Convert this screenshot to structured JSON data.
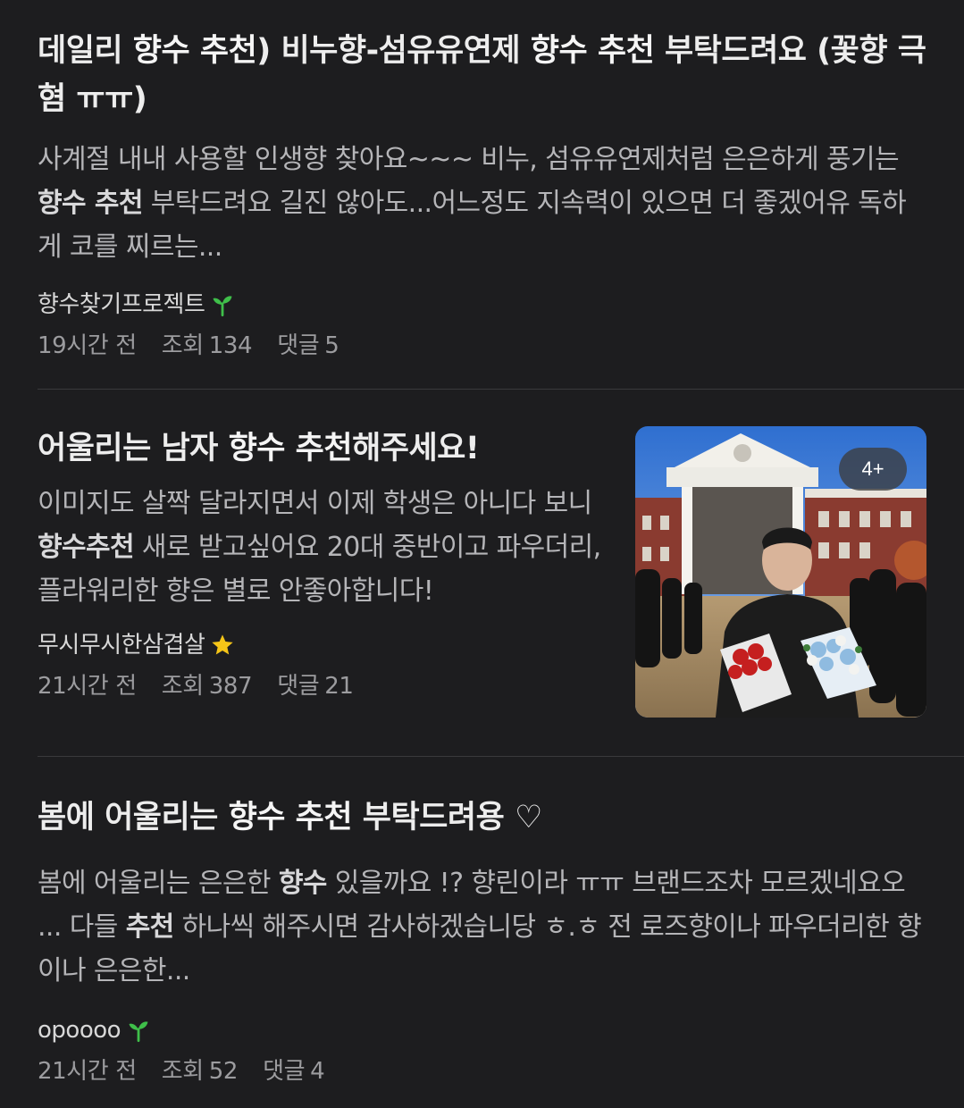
{
  "posts": [
    {
      "title_segments": [
        {
          "text": "데일리 ",
          "bold": false
        },
        {
          "text": "향수 추천",
          "bold": true
        },
        {
          "text": ") 비누향-섬유유연제 ",
          "bold": false
        },
        {
          "text": "향수 추천",
          "bold": true
        },
        {
          "text": " 부탁드려요 (꽃향 극혐 ㅠㅠ)",
          "bold": false
        }
      ],
      "snippet_segments": [
        {
          "text": "사계절 내내 사용할 인생향 찾아요~~~ 비누, 섬유유연제처럼 은은하게 풍기는 ",
          "bold": false
        },
        {
          "text": "향수 추천",
          "bold": true
        },
        {
          "text": " 부탁드려요 길진 않아도...어느정도 지속력이 있으면 더 좋겠어유 독하게 코를 찌르는...",
          "bold": false
        }
      ],
      "author": "향수찾기프로젝트",
      "author_badge_icon": "sprout-icon",
      "time": "19시간 전",
      "views_label": "조회",
      "views": "134",
      "comments_label": "댓글",
      "comments": "5"
    },
    {
      "title_segments": [
        {
          "text": "어울리는 남자 ",
          "bold": false
        },
        {
          "text": "향수 추천",
          "bold": true
        },
        {
          "text": "해주세요!",
          "bold": false
        }
      ],
      "snippet_segments": [
        {
          "text": "이미지도 살짝 달라지면서 이제 학생은 아니다 보니 ",
          "bold": false
        },
        {
          "text": "향수추천",
          "bold": true
        },
        {
          "text": " 새로 받고싶어요 20대 중반이고 파우더리, 플라워리한 향은 별로 안좋아합니다!",
          "bold": false
        }
      ],
      "author": "무시무시한삼겹살",
      "author_badge_icon": "star-icon",
      "time": "21시간 전",
      "views_label": "조회",
      "views": "387",
      "comments_label": "댓글",
      "comments": "21",
      "thumbnail_badge": "4+"
    },
    {
      "title_segments": [
        {
          "text": "봄에 어울리는 ",
          "bold": false
        },
        {
          "text": "향수 추천",
          "bold": true
        },
        {
          "text": " 부탁드려용 ♡",
          "bold": false
        }
      ],
      "snippet_segments": [
        {
          "text": "봄에 어울리는 은은한 ",
          "bold": false
        },
        {
          "text": "향수",
          "bold": true
        },
        {
          "text": " 있을까요 !? 향린이라 ㅠㅠ 브랜드조차 모르겠네요오 ... 다들 ",
          "bold": false
        },
        {
          "text": "추천",
          "bold": true
        },
        {
          "text": " 하나씩 해주시면 감사하겠습니당 ㅎ.ㅎ 전 로즈향이나 파우더리한 향이나 은은한...",
          "bold": false
        }
      ],
      "author": "opoooo",
      "author_badge_icon": "sprout-icon",
      "time": "21시간 전",
      "views_label": "조회",
      "views": "52",
      "comments_label": "댓글",
      "comments": "4"
    }
  ],
  "colors": {
    "background": "#1d1d1f",
    "sprout": "#3fbf4a",
    "star": "#f5c518"
  }
}
